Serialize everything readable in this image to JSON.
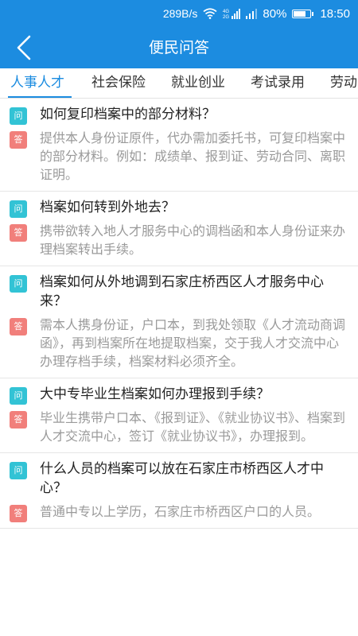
{
  "status_bar": {
    "net_speed": "289B/s",
    "net_type": "4G 2G",
    "battery": "80%",
    "battery_level": 0.8,
    "time": "18:50"
  },
  "header": {
    "title": "便民问答"
  },
  "tabs": [
    {
      "label": "人事人才",
      "active": true
    },
    {
      "label": "社会保险",
      "active": false
    },
    {
      "label": "就业创业",
      "active": false
    },
    {
      "label": "考试录用",
      "active": false
    },
    {
      "label": "劳动",
      "active": false
    }
  ],
  "badges": {
    "question": "问",
    "answer": "答"
  },
  "qa_items": [
    {
      "question": "如何复印档案中的部分材料？",
      "answer": "提供本人身份证原件，代办需加委托书，可复印档案中的部分材料。例如：成绩单、报到证、劳动合同、离职证明。"
    },
    {
      "question": "档案如何转到外地去？",
      "answer": "携带欲转入地人才服务中心的调档函和本人身份证来办理档案转出手续。"
    },
    {
      "question": "档案如何从外地调到石家庄桥西区人才服务中心来？",
      "answer": "需本人携身份证，户口本，到我处领取《人才流动商调函》，再到档案所在地提取档案，交于我人才交流中心办理存档手续，档案材料必须齐全。"
    },
    {
      "question": "大中专毕业生档案如何办理报到手续？",
      "answer": "毕业生携带户口本、《报到证》、《就业协议书》、档案到人才交流中心，签订《就业协议书》，办理报到。"
    },
    {
      "question": "什么人员的档案可以放在石家庄市桥西区人才中心？",
      "answer": "普通中专以上学历，石家庄市桥西区户口的人员。"
    }
  ],
  "colors": {
    "primary": "#1c8ce0",
    "question_badge": "#32c3d5",
    "answer_badge": "#f17f7b",
    "answer_text": "#9a9a9a"
  }
}
